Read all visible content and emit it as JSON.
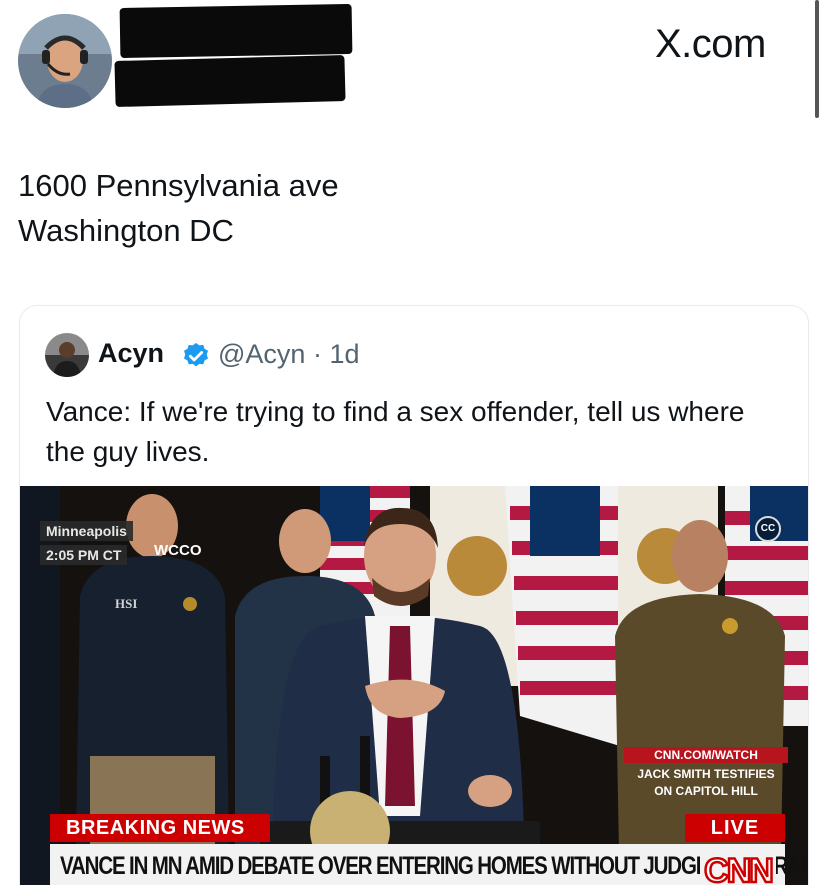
{
  "header": {
    "author_name": "",
    "author_handle": "",
    "source": "X.com"
  },
  "tweet": {
    "text_line1": "1600 Pennsylvania ave",
    "text_line2": "Washington DC"
  },
  "quoted_tweet": {
    "name": "Acyn",
    "handle": "@Acyn",
    "age": "1d",
    "text": "Vance: If we're trying to find a sex offender, tell us where the guy lives.",
    "media": {
      "location": "Minneapolis",
      "time": "2:05 PM CT",
      "station": "WCCO",
      "cc_label": "CC",
      "watch_label": "CNN.COM/WATCH",
      "side_headline_line1": "JACK SMITH TESTIFIES",
      "side_headline_line2": "ON CAPITOL HILL",
      "breaking_label": "BREAKING NEWS",
      "live_label": "LIVE",
      "chyron": "VANCE IN MN AMID DEBATE OVER ENTERING HOMES WITHOUT JUDGE'S WARRANT",
      "network_logo": "CNN",
      "vest_text": "HSI"
    }
  },
  "colors": {
    "verified": "#1d9bf0",
    "handle_gray": "#536471",
    "cnn_red": "#cc0000"
  }
}
